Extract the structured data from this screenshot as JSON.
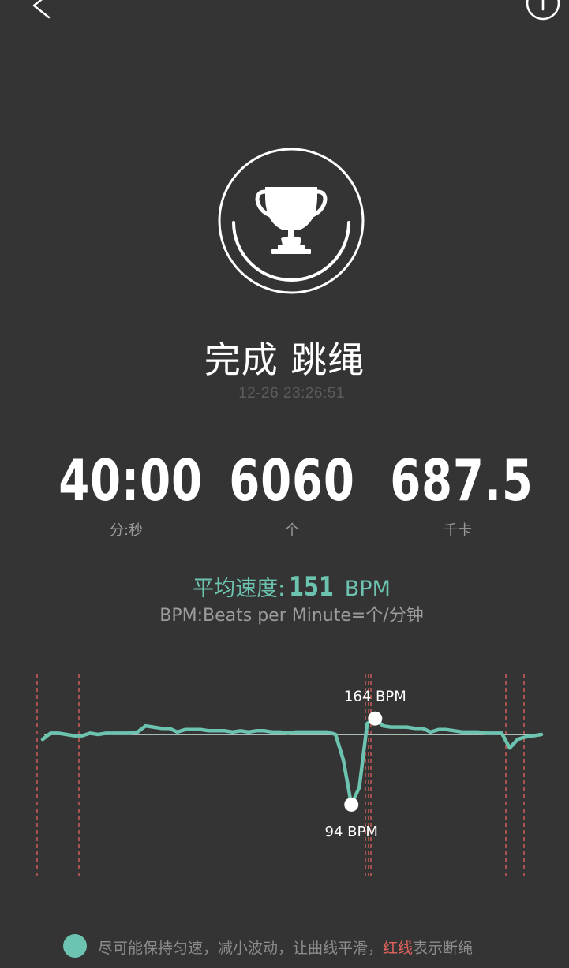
{
  "header": {
    "back_icon": "chevron-left-icon",
    "share_icon": "share-icon"
  },
  "badge": {
    "icon": "trophy-icon"
  },
  "title": "完成 跳绳",
  "datetime": "12-26 23:26:51",
  "stats": [
    {
      "value": "40:00",
      "unit": "分:秒"
    },
    {
      "value": "6060",
      "unit": "个"
    },
    {
      "value": "687.5",
      "unit": "千卡"
    }
  ],
  "average": {
    "label": "平均速度:",
    "value": "151",
    "unit": "BPM"
  },
  "bpm_description": "BPM:Beats per Minute=个/分钟",
  "chart_data": {
    "type": "line",
    "average_bpm": 151,
    "max": {
      "value": 164,
      "label": "164 BPM"
    },
    "min": {
      "value": 94,
      "label": "94 BPM"
    },
    "series": [
      {
        "values": [
          147,
          152,
          152,
          151,
          150,
          150,
          152,
          151,
          152,
          152,
          152,
          152,
          153,
          158,
          157,
          156,
          156,
          153,
          155,
          155,
          155,
          154,
          154,
          154,
          153,
          154,
          153,
          154,
          154,
          153,
          153,
          152,
          153,
          153,
          153,
          153,
          153,
          151,
          130,
          94,
          108,
          160,
          164,
          158,
          157,
          157,
          157,
          156,
          156,
          153,
          155,
          155,
          154,
          153,
          153,
          153,
          152,
          152,
          152,
          140,
          147,
          149,
          150,
          151
        ]
      }
    ],
    "break_markers_count": 8,
    "colors": {
      "line": "#6cc3b0",
      "average_line": "#cfe9e2",
      "break_marker": "#e3645f",
      "point": "#ffffff",
      "label": "#ffffff"
    }
  },
  "footer": {
    "text_normal": "尽可能保持匀速，减小波动，让曲线平滑，",
    "text_red": "红线",
    "text_end": "表示断绳"
  },
  "colors": {
    "background": "#343434",
    "accent": "#6cc3b0",
    "break_red": "#e3645f",
    "muted_text": "#9a9a9a",
    "timestamp": "#5c5c5c"
  }
}
